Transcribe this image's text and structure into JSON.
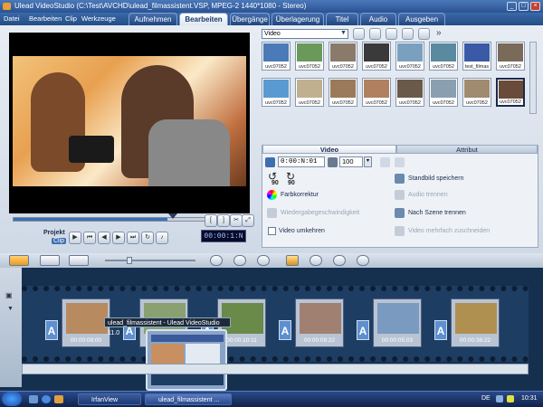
{
  "window": {
    "title": "Ulead VideoStudio (C:\\Test\\AVCHD\\ulead_filmassistent.VSP, MPEG-2 1440*1080 - Stereo)"
  },
  "menu": [
    "Datei",
    "Bearbeiten",
    "Clip",
    "Werkzeuge"
  ],
  "steps": [
    {
      "label": "Aufnehmen",
      "active": false
    },
    {
      "label": "Bearbeiten",
      "active": true
    },
    {
      "label": "Übergänge",
      "active": false
    },
    {
      "label": "Überlagerung",
      "active": false
    },
    {
      "label": "Titel",
      "active": false
    },
    {
      "label": "Audio",
      "active": false
    },
    {
      "label": "Ausgeben",
      "active": false
    }
  ],
  "library": {
    "category": "Video",
    "thumbs": [
      {
        "label": "uvc07052",
        "color": "#4a7ab8"
      },
      {
        "label": "uvc07052",
        "color": "#6a9a5a"
      },
      {
        "label": "uvc07052",
        "color": "#8a7a6a"
      },
      {
        "label": "uvc07052",
        "color": "#3a3a3a"
      },
      {
        "label": "uvc07052",
        "color": "#7aa0c0"
      },
      {
        "label": "uvc07052",
        "color": "#5a8aa0"
      },
      {
        "label": "test_filmas",
        "color": "#3a5aa8"
      },
      {
        "label": "uvc07052",
        "color": "#7a6a5a"
      },
      {
        "label": "uvc07052",
        "color": "#5a9ad0"
      },
      {
        "label": "uvc07052",
        "color": "#c0b090"
      },
      {
        "label": "uvc07052",
        "color": "#9a7a5a"
      },
      {
        "label": "uvc07052",
        "color": "#b08060"
      },
      {
        "label": "uvc07052",
        "color": "#6a5a4a"
      },
      {
        "label": "uvc07052",
        "color": "#8aa0b0"
      },
      {
        "label": "uvc07052",
        "color": "#a08a70"
      },
      {
        "label": "uvc07052",
        "color": "#6a4a3a"
      }
    ]
  },
  "options": {
    "tab_video": "Video",
    "tab_attribut": "Attribut",
    "duration": "0:00:N:01",
    "volume": "100",
    "angle_left": "90",
    "angle_right": "90",
    "farbkorrektur": "Farbkorrektur",
    "wiedergabe": "Wiedergabegeschwindigkeit",
    "video_umkehren": "Video umkehren",
    "standbild": "Standbild speichern",
    "audio_trennen": "Audio trennen",
    "nach_szene": "Nach Szene trennen",
    "mehrfach": "Video mehrfach zuschneiden"
  },
  "player": {
    "projekt": "Projekt",
    "clip": "Clip",
    "timecode": "00:00:1:N"
  },
  "timeline": {
    "clips": [
      {
        "tc": "00:00:08:00",
        "color": "#b88a60"
      },
      {
        "tc": "00:00:09:22",
        "color": "#8aa070"
      },
      {
        "tc": "00:00:10:11",
        "color": "#6a8a4a"
      },
      {
        "tc": "00:00:09:22",
        "color": "#a08070"
      },
      {
        "tc": "00:00:05:03",
        "color": "#7a9ac0"
      },
      {
        "tc": "00:00:38:22",
        "color": "#b09050"
      }
    ],
    "tooltip": "ulead_filmassistent - Ulead VideoStudio 11.0"
  },
  "taskbar": {
    "items": [
      {
        "label": "IrfanView",
        "active": false
      },
      {
        "label": "ulead_filmassistent ...",
        "active": true
      }
    ],
    "lang": "DE",
    "clock": "10:31"
  }
}
